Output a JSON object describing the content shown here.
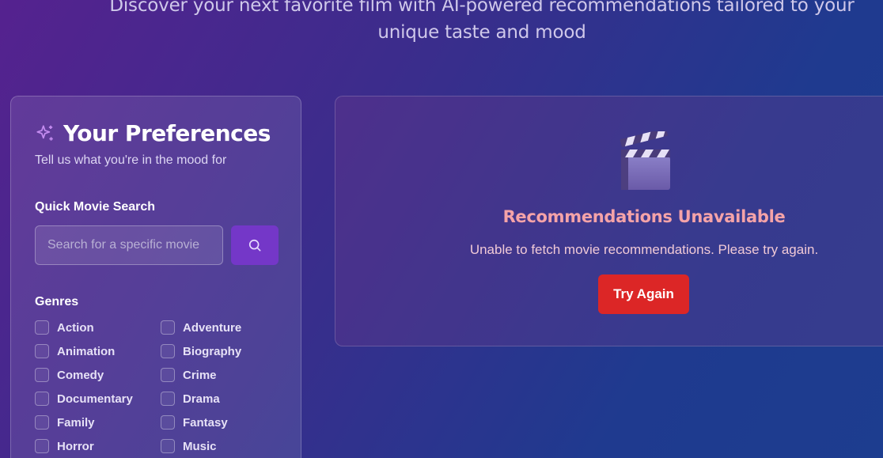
{
  "header": {
    "subtitle_line1": "Discover your next favorite film with AI-powered recommendations tailored to your",
    "subtitle_line2": "unique taste and mood"
  },
  "preferences": {
    "title": "Your Preferences",
    "subtitle": "Tell us what you're in the mood for",
    "search": {
      "label": "Quick Movie Search",
      "placeholder": "Search for a specific movie",
      "value": ""
    },
    "genres": {
      "label": "Genres",
      "items": [
        "Action",
        "Adventure",
        "Animation",
        "Biography",
        "Comedy",
        "Crime",
        "Documentary",
        "Drama",
        "Family",
        "Fantasy",
        "Horror",
        "Music"
      ]
    }
  },
  "recommendations": {
    "icon": "clapperboard-icon",
    "title": "Recommendations Unavailable",
    "message": "Unable to fetch movie recommendations. Please try again.",
    "button_label": "Try Again"
  },
  "colors": {
    "accent": "#7437c8",
    "error_title": "#f5a3a8",
    "error_button": "#dc2626"
  }
}
